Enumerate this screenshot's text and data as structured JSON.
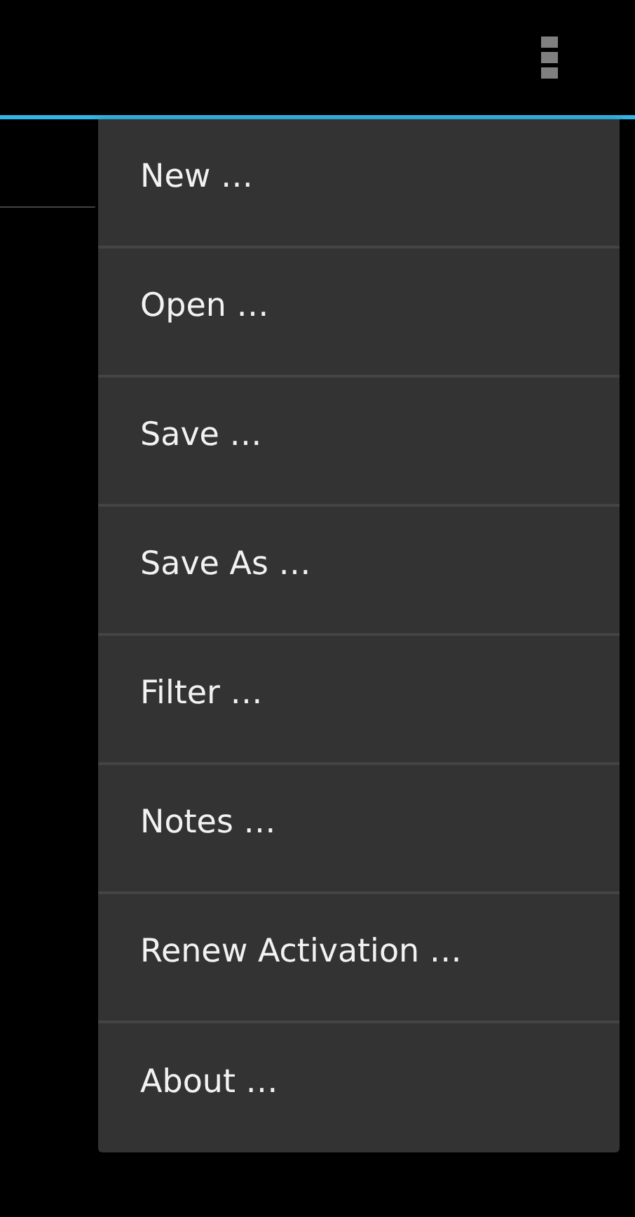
{
  "menu": {
    "items": [
      {
        "label": "New …"
      },
      {
        "label": "Open …"
      },
      {
        "label": "Save …"
      },
      {
        "label": "Save As …"
      },
      {
        "label": "Filter …"
      },
      {
        "label": "Notes …"
      },
      {
        "label": "Renew Activation …"
      },
      {
        "label": "About …"
      }
    ]
  }
}
